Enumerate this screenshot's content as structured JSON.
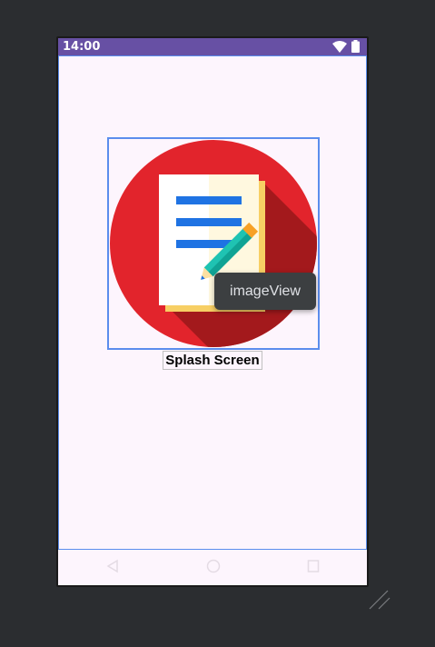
{
  "status_bar": {
    "time": "14:00",
    "color": "#6750a4"
  },
  "screen": {
    "background": "#fdf5fd",
    "image_view": {
      "icon": "notes-pencil-icon"
    },
    "title_text": "Splash Screen"
  },
  "tooltip": {
    "text": "imageView"
  },
  "nav_bar": {
    "icons": [
      "back-icon",
      "home-icon",
      "recents-icon"
    ]
  },
  "colors": {
    "selection": "#5b8ded",
    "canvas": "#2b2d30"
  }
}
